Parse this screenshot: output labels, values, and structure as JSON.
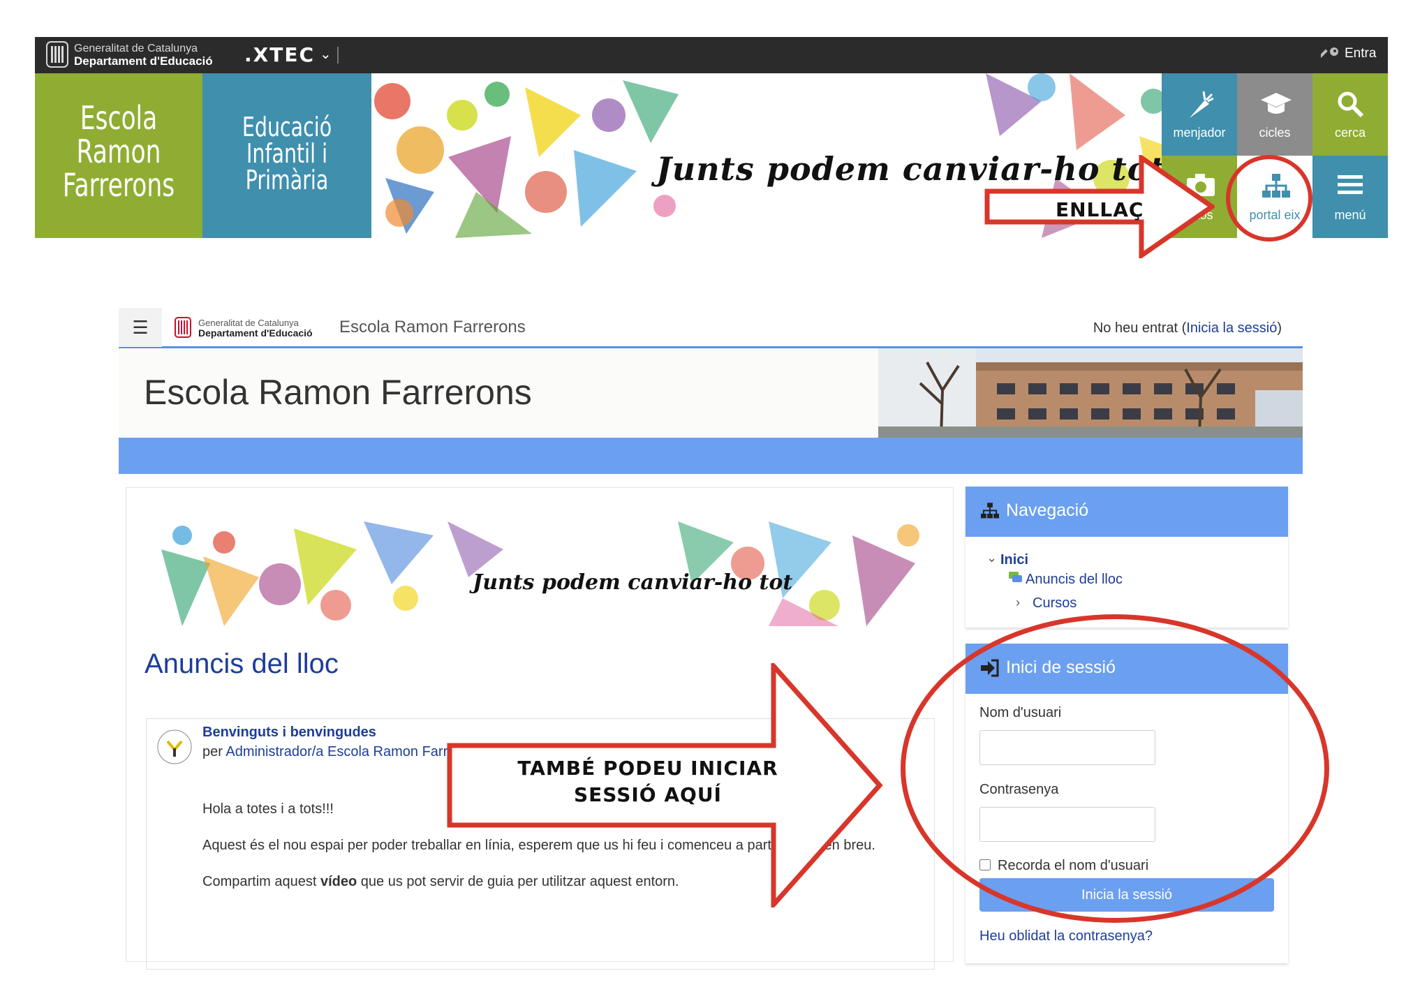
{
  "top_site": {
    "gencat_line1": "Generalitat de Catalunya",
    "gencat_line2": "Departament d'Educació",
    "xtec_label": ".XTEC",
    "entra_label": "Entra",
    "escola_line1": "Escola",
    "escola_line2": "Ramon",
    "escola_line3": "Farrerons",
    "edu_line1": "Educació",
    "edu_line2": "Infantil i",
    "edu_line3": "Primària",
    "motto": "Junts podem canviar-ho tot",
    "tiles": {
      "menjador": "menjador",
      "cicles": "cicles",
      "cerca": "cerca",
      "fotos": "fotos",
      "portal": "portal eix",
      "menu": "menú"
    },
    "colors": {
      "green": "#8fad33",
      "blue": "#3f8fad",
      "gray": "#8c8c8c"
    }
  },
  "moodle": {
    "nav_site_name": "Escola Ramon Farrerons",
    "login_status_prefix": "No heu entrat (",
    "login_status_link": "Inicia la sessió",
    "login_status_suffix": ")",
    "header_title": "Escola Ramon Farrerons",
    "content_motto": "Junts podem canviar-ho tot",
    "anuncis_heading": "Anuncis del lloc",
    "post": {
      "title": "Benvinguts i benvingudes",
      "byline_prefix": "per ",
      "byline_author": "Administrador/a Escola Ramon Farrerons",
      "p1": "Hola a totes i a tots!!!",
      "p2": "Aquest és el nou espai per poder treballar en línia, esperem que us hi feu i comenceu a participar-hi en breu.",
      "p3_pre": "Compartim aquest ",
      "p3_bold": "vídeo",
      "p3_post": " que us pot servir de guia per utilitzar aquest entorn."
    },
    "nav_block": {
      "title": "Navegació",
      "inici": "Inici",
      "anuncis": "Anuncis del lloc",
      "cursos": "Cursos"
    },
    "login_block": {
      "title": "Inici de sessió",
      "user_label": "Nom d'usuari",
      "user_value": "",
      "pass_label": "Contrasenya",
      "pass_value": "",
      "remember_label": "Recorda el nom d'usuari",
      "remember_checked": false,
      "button": "Inicia la sessió",
      "forgot": "Heu oblidat la contrasenya?"
    },
    "colors": {
      "accent": "#6b9ff0",
      "link": "#1d3d9a"
    }
  },
  "annotations": {
    "top_arrow_text": "ENLLAÇ",
    "big_arrow_line1": "TAMBÉ PODEU INICIAR",
    "big_arrow_line2": "SESSIÓ AQUÍ",
    "color": "#d8362a"
  }
}
